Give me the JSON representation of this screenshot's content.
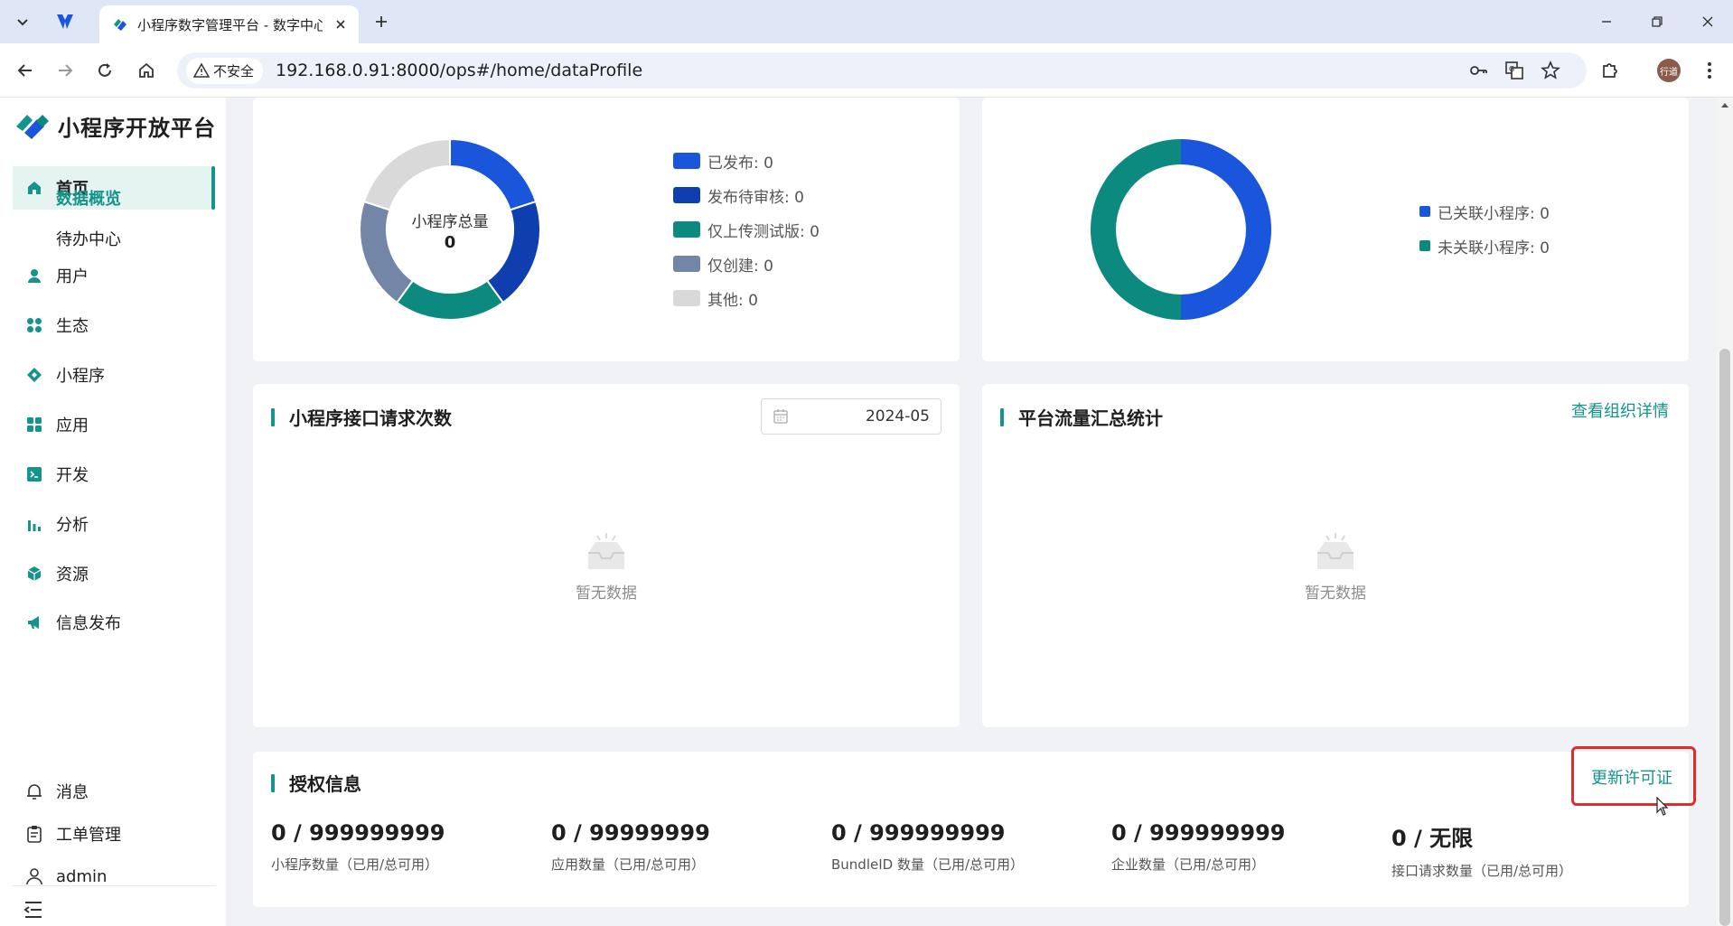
{
  "browser": {
    "tab_title": "小程序数字管理平台 - 数字中心",
    "security_label": "不安全",
    "url": "192.168.0.91:8000/ops#/home/dataProfile",
    "profile_label": "行道"
  },
  "sidebar": {
    "logo_text": "小程序开放平台",
    "home": "首页",
    "sub_data_overview": "数据概览",
    "sub_todo": "待办中心",
    "items": [
      {
        "label": "用户",
        "icon": "user-icon"
      },
      {
        "label": "生态",
        "icon": "grid-icon"
      },
      {
        "label": "小程序",
        "icon": "diamond-icon"
      },
      {
        "label": "应用",
        "icon": "apps-icon"
      },
      {
        "label": "开发",
        "icon": "terminal-icon"
      },
      {
        "label": "分析",
        "icon": "bar-chart-icon"
      },
      {
        "label": "资源",
        "icon": "cube-icon"
      },
      {
        "label": "信息发布",
        "icon": "megaphone-icon"
      }
    ],
    "messages": "消息",
    "tickets": "工单管理",
    "user": "admin"
  },
  "miniapp_chart": {
    "center_label": "小程序总量",
    "center_value": "0",
    "legend": [
      {
        "label": "已发布: 0",
        "color": "#1a56db"
      },
      {
        "label": "发布待审核: 0",
        "color": "#0f3fae"
      },
      {
        "label": "仅上传测试版: 0",
        "color": "#0c8a80"
      },
      {
        "label": "仅创建: 0",
        "color": "#7386a8"
      },
      {
        "label": "其他: 0",
        "color": "#d9d9d9"
      }
    ]
  },
  "relation_chart": {
    "legend": [
      {
        "label": "已关联小程序: 0",
        "color": "#1a56db"
      },
      {
        "label": "未关联小程序: 0",
        "color": "#0c8a80"
      }
    ]
  },
  "api_card": {
    "title": "小程序接口请求次数",
    "date": "2024-05",
    "empty": "暂无数据"
  },
  "traffic_card": {
    "title": "平台流量汇总统计",
    "link": "查看组织详情",
    "empty": "暂无数据"
  },
  "license_card": {
    "title": "授权信息",
    "update_link": "更新许可证",
    "stats": [
      {
        "value": "0 / 999999999",
        "label": "小程序数量（已用/总可用）"
      },
      {
        "value": "0 / 99999999",
        "label": "应用数量（已用/总可用）"
      },
      {
        "value": "0 / 999999999",
        "label": "BundleID 数量（已用/总可用）"
      },
      {
        "value": "0 / 999999999",
        "label": "企业数量（已用/总可用）"
      },
      {
        "value": "0 / 无限",
        "label": "接口请求数量（已用/总可用）"
      }
    ]
  },
  "colors": {
    "accent": "#14948a",
    "highlight": "#e02c2c"
  }
}
